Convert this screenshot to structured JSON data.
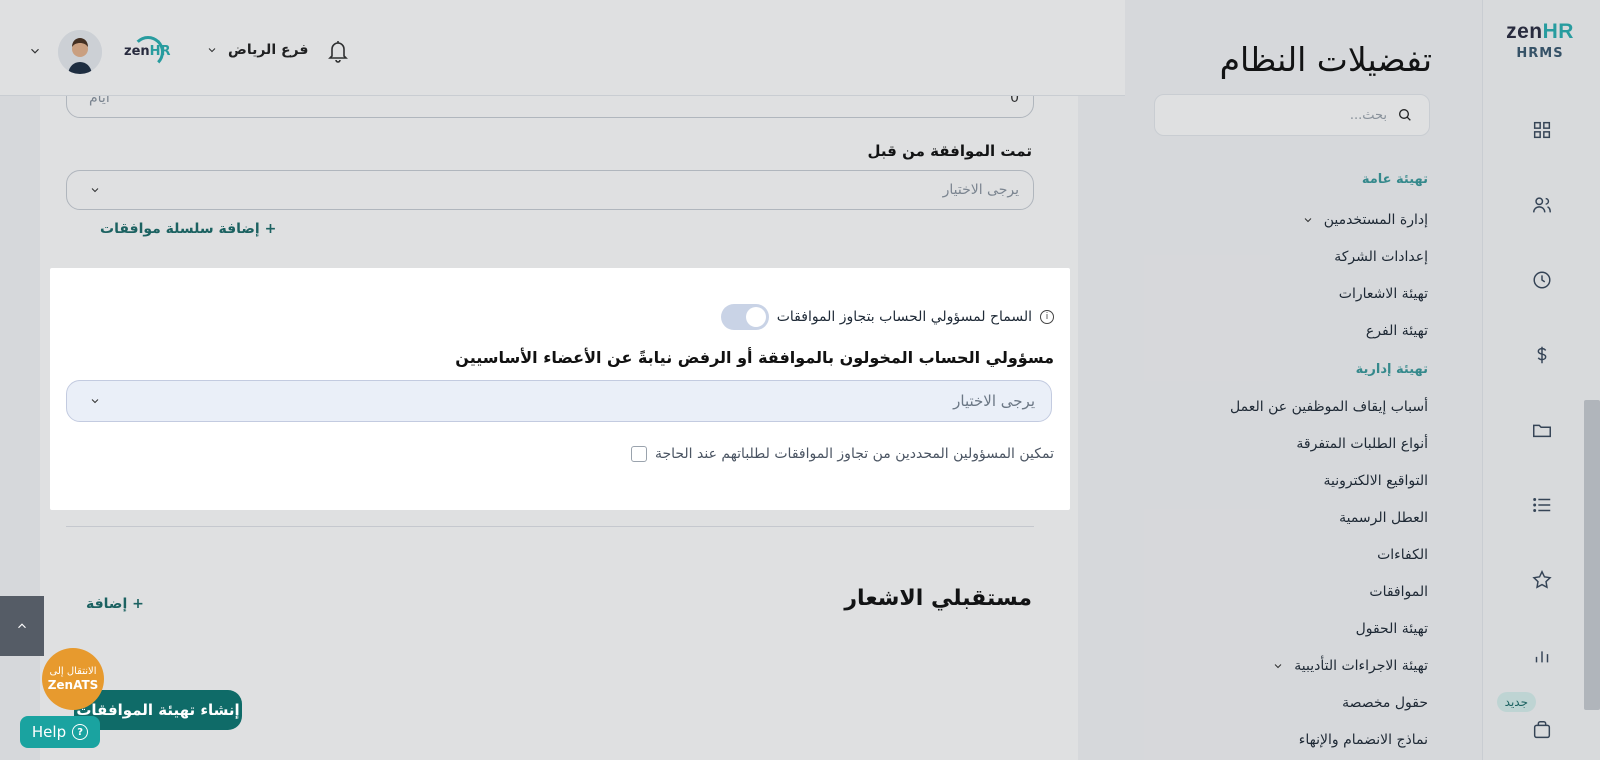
{
  "brand": {
    "logo_zen": "zen",
    "logo_hr": "HR",
    "product": "HRMS"
  },
  "rail": {
    "new_badge": "جديد"
  },
  "settings": {
    "title": "تفضيلات النظام",
    "search_placeholder": "بحث...",
    "sections": [
      {
        "label": "تهيئة عامة"
      },
      {
        "label": "تهيئة إدارية"
      }
    ],
    "items": [
      "إدارة المستخدمين",
      "إعدادات الشركة",
      "تهيئة الاشعارات",
      "تهيئة الفرع",
      "أسباب إيقاف الموظفين عن العمل",
      "أنواع الطلبات المتفرقة",
      "التواقيع الالكترونية",
      "العطل الرسمية",
      "الكفاءات",
      "الموافقات",
      "تهيئة الحقول",
      "تهيئة الاجراءات التأديبية",
      "حقول مخصصة",
      "نماذج الانضمام والإنهاء"
    ]
  },
  "header": {
    "branch": "فرع الرياض",
    "zen": "zen",
    "hr": "HR"
  },
  "main": {
    "days_value": "0",
    "days_unit": "أيام",
    "approved_by_label": "تمت الموافقة من قبل",
    "select_placeholder": "يرجى الاختيار",
    "add_chain": "+ إضافة سلسلة موافقات",
    "notif_title": "مستقبلي الاشعار",
    "add": "+ إضافة"
  },
  "modal": {
    "toggle_label": "السماح لمسؤولي الحساب بتجاوز الموافقات",
    "info_glyph": "i",
    "field_label": "مسؤولي الحساب المخولون بالموافقة أو الرفض نيابةً عن الأعضاء الأساسيين",
    "select_placeholder": "يرجى الاختيار",
    "checkbox_label": "تمكين المسؤولين المحددين من تجاوز الموافقات لطلباتهم عند الحاجة"
  },
  "floating": {
    "create_button": "إنشاء تهيئة الموافقات",
    "zenats_line1": "الانتقال إلى",
    "zenats_line2": "ZenATS",
    "help": "Help",
    "help_glyph": "?"
  }
}
